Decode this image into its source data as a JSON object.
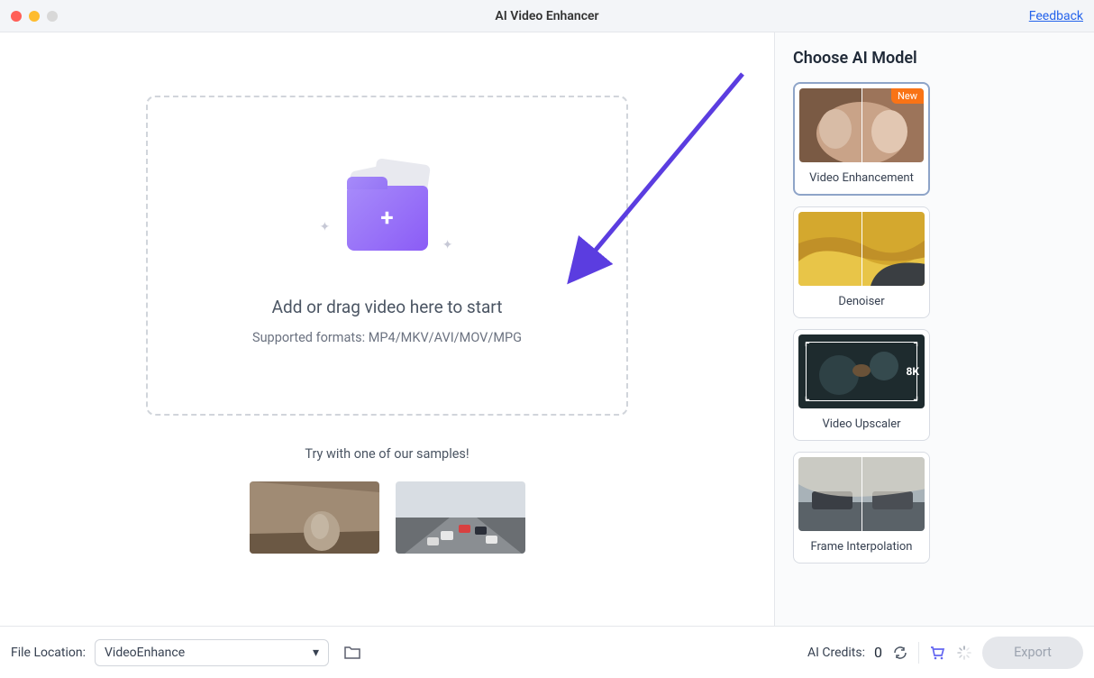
{
  "titlebar": {
    "title": "AI Video Enhancer",
    "feedback": "Feedback"
  },
  "dropzone": {
    "title": "Add or drag video here to start",
    "subtitle": "Supported formats: MP4/MKV/AVI/MOV/MPG"
  },
  "samples": {
    "heading": "Try with one of our samples!"
  },
  "sidebar": {
    "heading": "Choose AI Model",
    "models": [
      {
        "label": "Video Enhancement",
        "badge": "New",
        "selected": true
      },
      {
        "label": "Denoiser"
      },
      {
        "label": "Video Upscaler"
      },
      {
        "label": "Frame Interpolation"
      }
    ]
  },
  "footer": {
    "filelocation_label": "File Location:",
    "filelocation_value": "VideoEnhance",
    "credits_label": "AI Credits:",
    "credits_value": "0",
    "export": "Export"
  },
  "upscaler": {
    "eightk": "8K"
  }
}
